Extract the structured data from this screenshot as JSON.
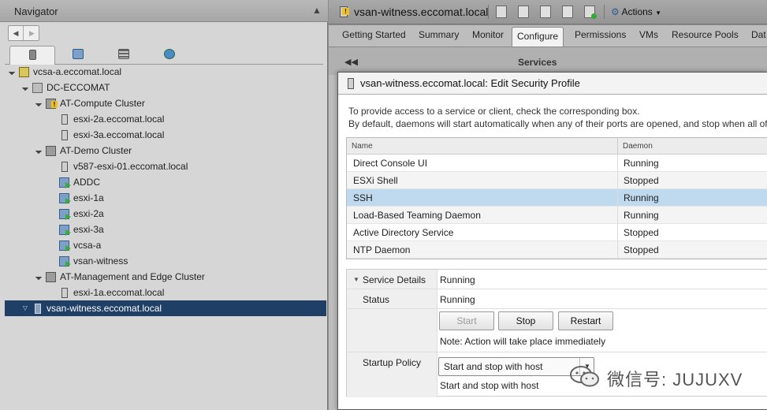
{
  "navigator": {
    "title": "Navigator",
    "pin_icon": "pin-icon",
    "history_back": "◀",
    "history_forward": "▶",
    "tabs": [
      {
        "icon": "hosts-clusters-icon",
        "active": true
      },
      {
        "icon": "vms-templates-icon",
        "active": false
      },
      {
        "icon": "storage-icon",
        "active": false
      },
      {
        "icon": "networking-icon",
        "active": false
      }
    ],
    "tree": [
      {
        "label": "vcsa-a.eccomat.local",
        "type": "vcenter",
        "indent": 0,
        "expanded": true
      },
      {
        "label": "DC-ECCOMAT",
        "type": "datacenter",
        "indent": 1,
        "expanded": true
      },
      {
        "label": "AT-Compute Cluster",
        "type": "cluster-warning",
        "indent": 2,
        "expanded": true
      },
      {
        "label": "esxi-2a.eccomat.local",
        "type": "host",
        "indent": 3
      },
      {
        "label": "esxi-3a.eccomat.local",
        "type": "host",
        "indent": 3
      },
      {
        "label": "AT-Demo Cluster",
        "type": "cluster",
        "indent": 2,
        "expanded": true
      },
      {
        "label": "v587-esxi-01.eccomat.local",
        "type": "host",
        "indent": 3
      },
      {
        "label": "ADDC",
        "type": "vm",
        "indent": 3
      },
      {
        "label": "esxi-1a",
        "type": "vm",
        "indent": 3
      },
      {
        "label": "esxi-2a",
        "type": "vm",
        "indent": 3
      },
      {
        "label": "esxi-3a",
        "type": "vm",
        "indent": 3
      },
      {
        "label": "vcsa-a",
        "type": "vm",
        "indent": 3
      },
      {
        "label": "vsan-witness",
        "type": "vm",
        "indent": 3
      },
      {
        "label": "AT-Management and Edge Cluster",
        "type": "cluster",
        "indent": 2,
        "expanded": true
      },
      {
        "label": "esxi-1a.eccomat.local",
        "type": "host",
        "indent": 3
      },
      {
        "label": "vsan-witness.eccomat.local",
        "type": "host",
        "indent": 1,
        "selected": true,
        "expandable": true
      }
    ]
  },
  "object": {
    "title": "vsan-witness.eccomat.local",
    "actions_label": "Actions",
    "tabs": [
      "Getting Started",
      "Summary",
      "Monitor",
      "Configure",
      "Permissions",
      "VMs",
      "Resource Pools",
      "Dat"
    ],
    "active_tab": "Configure",
    "collapse_glyph": "◀◀",
    "section_header": "Services"
  },
  "dialog": {
    "title": "vsan-witness.eccomat.local: Edit Security Profile",
    "intro_line1": "To provide access to a service or client, check the corresponding box.",
    "intro_line2": "By default, daemons will start automatically when any of their ports are opened, and stop when all of",
    "columns": {
      "name": "Name",
      "daemon": "Daemon"
    },
    "services": [
      {
        "name": "Direct Console UI",
        "daemon": "Running"
      },
      {
        "name": "ESXi Shell",
        "daemon": "Stopped"
      },
      {
        "name": "SSH",
        "daemon": "Running",
        "selected": true
      },
      {
        "name": "Load-Based Teaming Daemon",
        "daemon": "Running"
      },
      {
        "name": "Active Directory Service",
        "daemon": "Stopped"
      },
      {
        "name": "NTP Daemon",
        "daemon": "Stopped"
      }
    ],
    "details": {
      "section_label": "Service Details",
      "section_value": "Running",
      "status_label": "Status",
      "status_value": "Running",
      "start_label": "Start",
      "stop_label": "Stop",
      "restart_label": "Restart",
      "note": "Note: Action will take place immediately",
      "policy_label": "Startup Policy",
      "policy_selected": "Start and stop with host",
      "policy_text": "Start and stop with host"
    }
  },
  "watermark": {
    "text": "微信号: JUJUXV"
  },
  "colors": {
    "selection_dark": "#1f3f66",
    "selection_light": "#bfd9ef",
    "running_status": "#222222"
  }
}
